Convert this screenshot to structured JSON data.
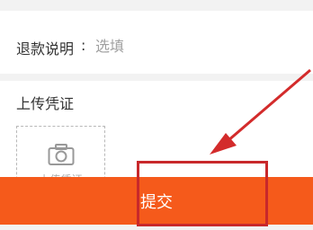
{
  "form": {
    "refund_reason_label": "退款说明",
    "refund_reason_colon": ":",
    "refund_reason_placeholder": "选填",
    "proof_title": "上传凭证",
    "upload_label": "上传凭证"
  },
  "footer": {
    "submit_label": "提交"
  },
  "colors": {
    "accent": "#f55a1b",
    "annotation_red": "#d32b2b",
    "background": "#f2f2f2"
  },
  "icons": {
    "upload": "camera-icon",
    "annotation": "red-arrow-icon"
  }
}
